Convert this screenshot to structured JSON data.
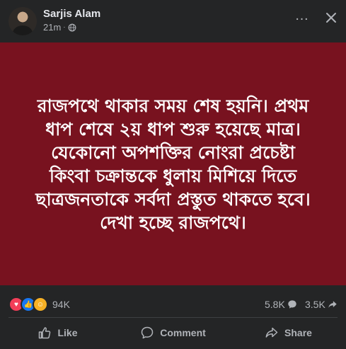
{
  "post": {
    "author": "Sarjis Alam",
    "time": "21m",
    "dot": "·",
    "privacy_icon": "globe-icon",
    "text": "রাজপথে থাকার সময় শেষ হয়নি। প্রথম\nধাপ শেষে ২য় ধাপ শুরু হয়েছে মাত্র।\nযেকোনো অপশক্তির নোংরা প্রচেষ্টা\nকিংবা চক্রান্তকে ধুলায় মিশিয়ে দিতে\nছাত্রজনতাকে সর্বদা প্রস্তুত থাকতে হবে।\nদেখা হচ্ছে রাজপথে।",
    "background_color": "#78121f"
  },
  "reactions": {
    "icons": [
      "love-icon",
      "like-icon",
      "care-icon"
    ],
    "count": "94K"
  },
  "comments_count": "5.8K",
  "shares_count": "3.5K",
  "actions": {
    "like": "Like",
    "comment": "Comment",
    "share": "Share"
  }
}
